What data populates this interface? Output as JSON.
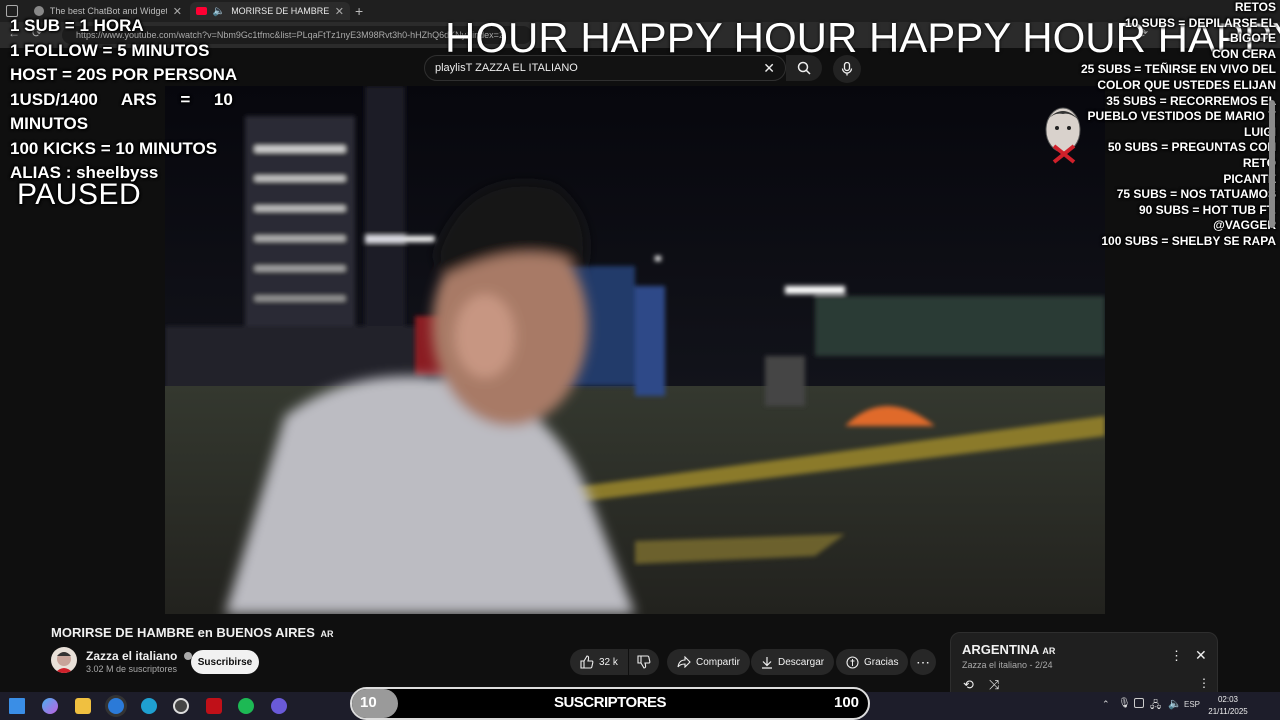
{
  "browser": {
    "tabs": [
      {
        "label": "The best ChatBot and Widgets fo"
      },
      {
        "label": "MORIRSE DE HAMBRE en BU"
      }
    ],
    "url": "https://www.youtube.com/watch?v=Nbm9Gc1tfmc&list=PLqaFtTz1nyE3M98Rvt3h0-hHZhQ6dKNy&index=2"
  },
  "search": {
    "value": "playlisT ZAZZA EL ITALIANO"
  },
  "overlay": {
    "left_lines": [
      "1 SUB = 1 HORA",
      "1 FOLLOW  = 5 MINUTOS",
      "HOST = 20S POR PERSONA",
      "1USD/1400     ARS     =     10",
      "MINUTOS",
      "100 KICKS = 10 MINUTOS",
      "ALIAS : sheelbyss"
    ],
    "paused": "PAUSED",
    "marquee": "HOUR HAPPY HOUR HAPPY HOUR HAPPY",
    "retos_title": "RETOS",
    "retos_lines": [
      "10 SUBS = DEPILARSE EL BIGOTE",
      "CON CERA",
      "25 SUBS = TEÑIRSE EN VIVO DEL",
      "COLOR QUE USTEDES ELIJAN",
      "35 SUBS = RECORREMOS EL",
      "PUEBLO VESTIDOS DE MARIO Y",
      "LUIGI",
      "50 SUBS = PREGUNTAS CON RETO",
      "PICANTE",
      "75 SUBS = NOS TATUAMOS",
      "90 SUBS  = HOT TUB FT. @VAGGER",
      "100 SUBS = SHELBY SE RAPA"
    ]
  },
  "video": {
    "title": "MORIRSE DE HAMBRE en BUENOS AIRES",
    "title_badge": "AR",
    "channel": "Zazza el italiano",
    "subscribers": "3.02 M de suscriptores",
    "subscribe_label": "Suscribirse",
    "likes": "32 k",
    "share_label": "Compartir",
    "download_label": "Descargar",
    "thanks_label": "Gracias"
  },
  "playlist": {
    "title": "ARGENTINA",
    "title_badge": "AR",
    "subtitle": "Zazza el italiano - 2/24"
  },
  "sub_goal": {
    "start": "10",
    "label": "SUSCRIPTORES",
    "goal": "100",
    "progress": 0.0
  },
  "tray": {
    "language": "ESP",
    "time": "02:03",
    "date": "21/11/2025"
  },
  "colors": {
    "youtube_red": "#ff0033",
    "subscribe_bg": "#f1f1f1"
  }
}
